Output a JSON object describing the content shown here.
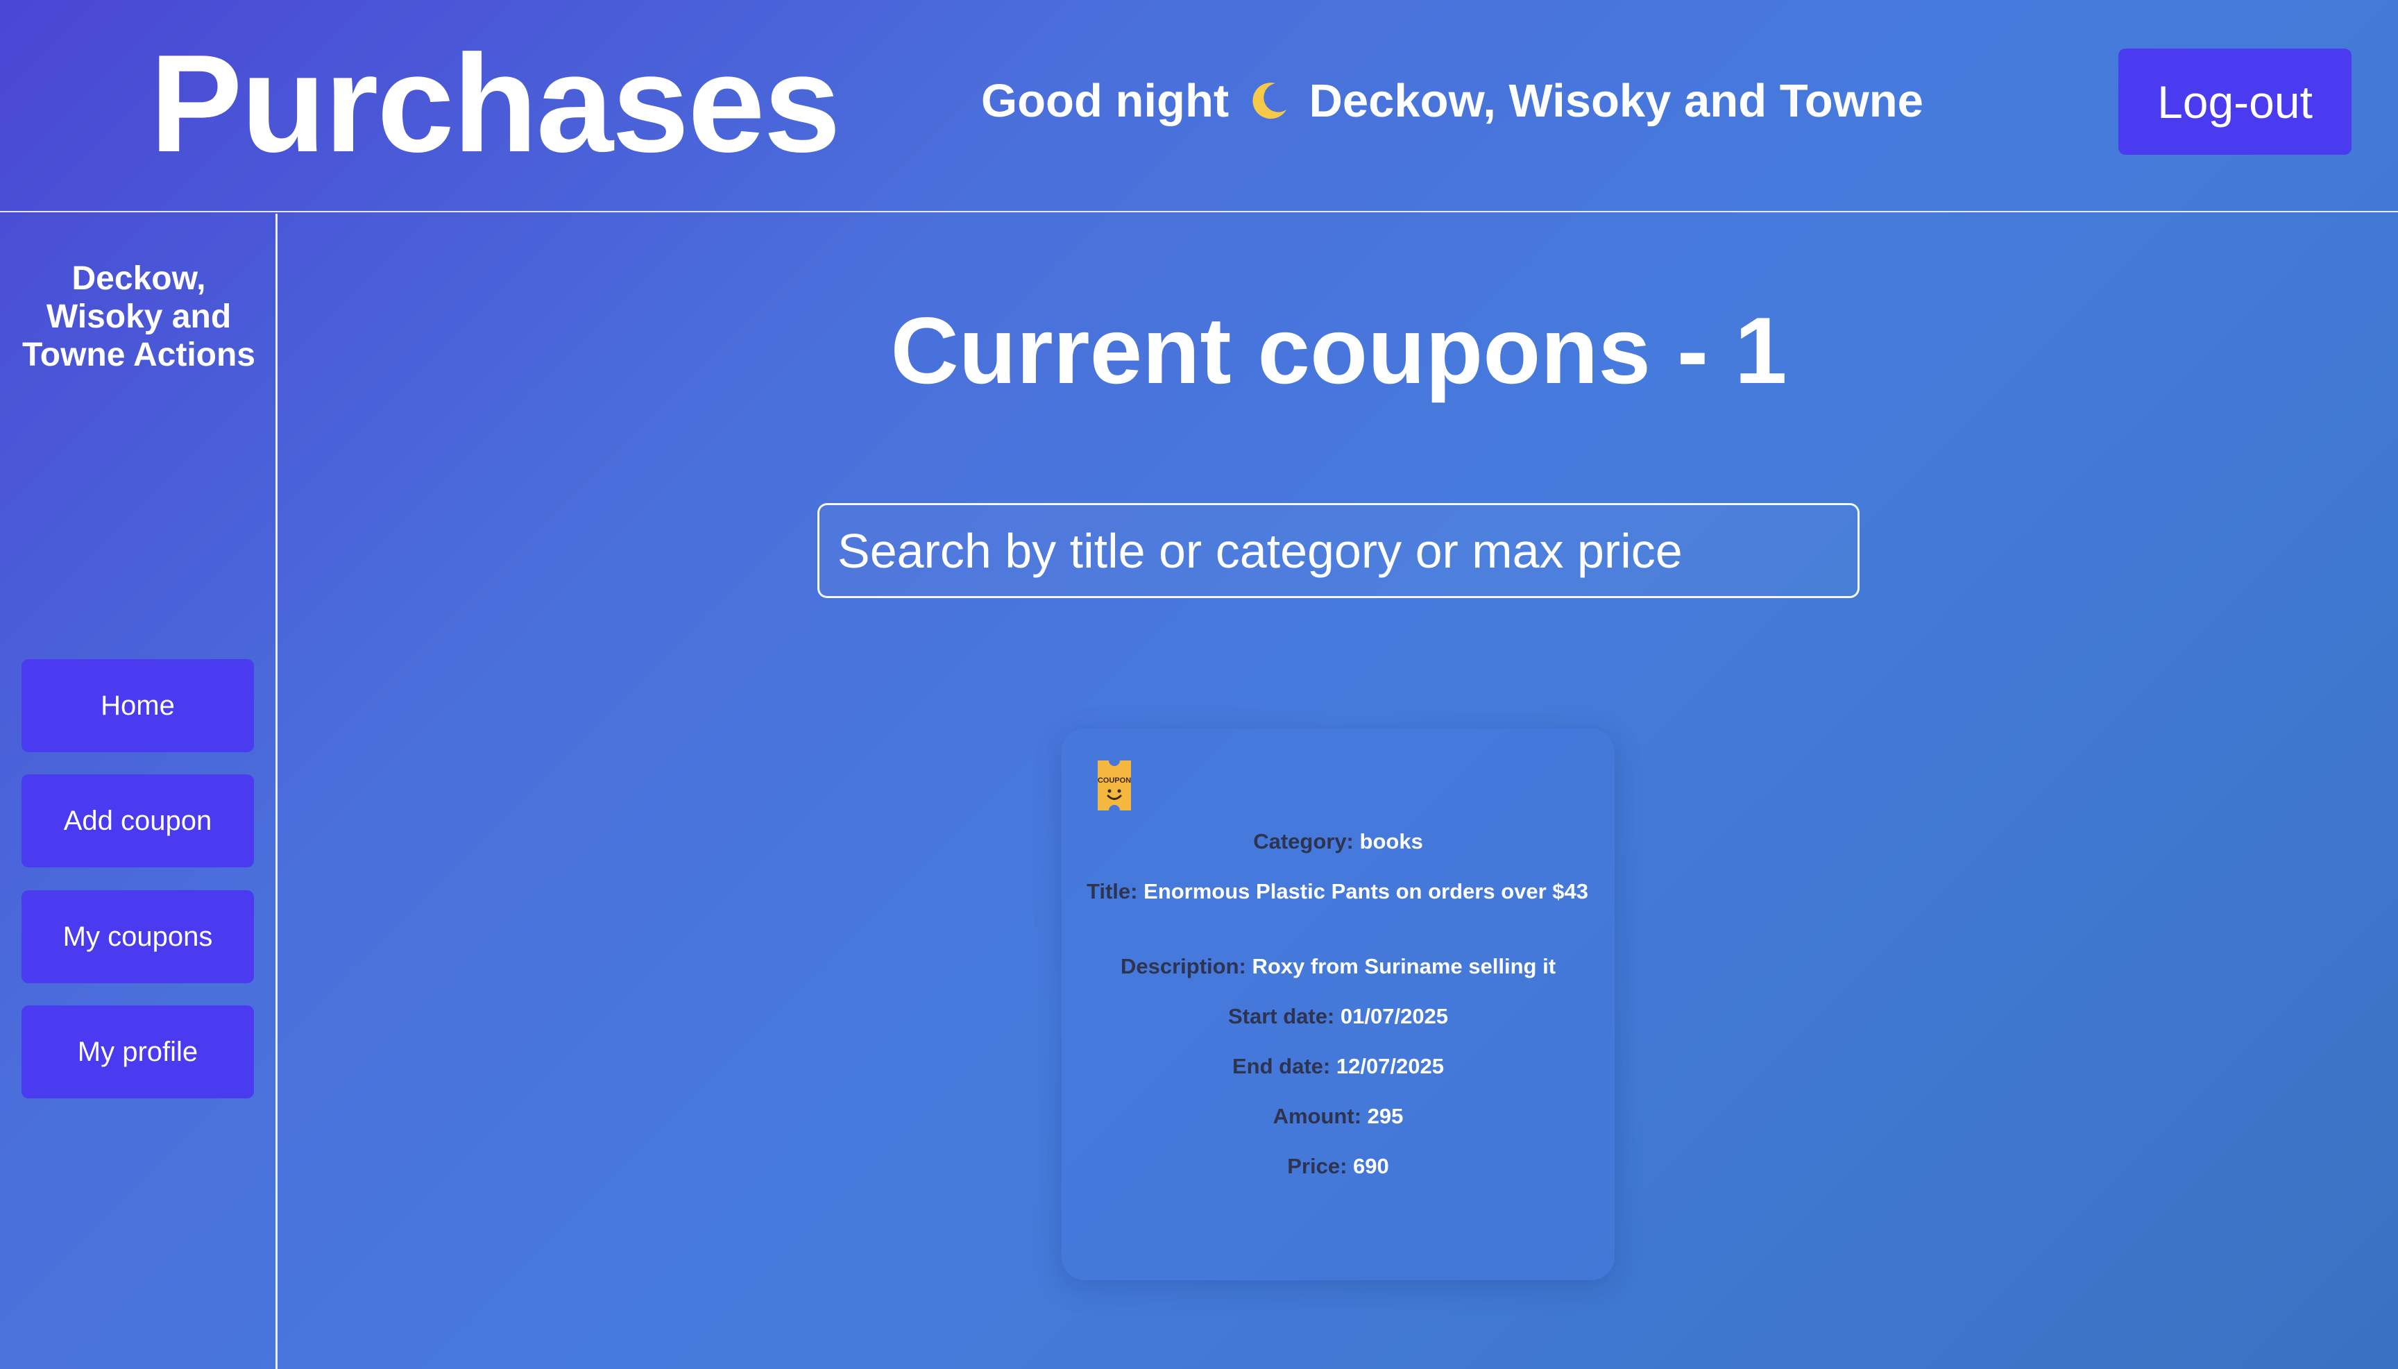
{
  "header": {
    "title": "Purchases",
    "greeting_prefix": "Good night",
    "greeting_icon": "moon-icon",
    "greeting_name": "Deckow, Wisoky and Towne",
    "logout_label": "Log-out"
  },
  "sidebar": {
    "title": "Deckow, Wisoky and Towne Actions",
    "items": [
      {
        "label": "Home"
      },
      {
        "label": "Add coupon"
      },
      {
        "label": "My coupons"
      },
      {
        "label": "My profile"
      }
    ]
  },
  "main": {
    "title": "Current coupons - 1",
    "search": {
      "placeholder": "Search by title or category or max price",
      "value": ""
    }
  },
  "coupons": [
    {
      "icon": "coupon-ticket-icon",
      "category_label": "Category:",
      "category": "books",
      "title_label": "Title:",
      "title": "Enormous Plastic Pants on orders over $43",
      "description_label": "Description:",
      "description": "Roxy from Suriname selling it",
      "start_date_label": "Start date:",
      "start_date": "01/07/2025",
      "end_date_label": "End date:",
      "end_date": "12/07/2025",
      "amount_label": "Amount:",
      "amount": "295",
      "price_label": "Price:",
      "price": "690"
    }
  ],
  "colors": {
    "button": "#4a3af0",
    "label_text": "#2e3350",
    "coupon_icon": "#f4b73f"
  }
}
